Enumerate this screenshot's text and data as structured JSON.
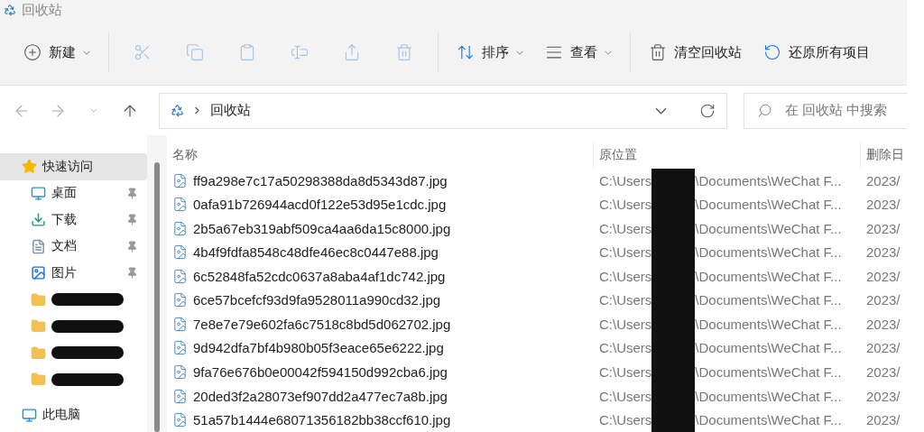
{
  "window": {
    "title": "回收站"
  },
  "toolbar": [
    {
      "kind": "new",
      "label": "新建",
      "dropdown": true,
      "disabled": false
    },
    {
      "kind": "cut",
      "disabled": true
    },
    {
      "kind": "copy",
      "disabled": true
    },
    {
      "kind": "paste",
      "disabled": true
    },
    {
      "kind": "rename",
      "disabled": true
    },
    {
      "kind": "share",
      "disabled": true
    },
    {
      "kind": "delete",
      "disabled": true
    },
    {
      "kind": "sort",
      "label": "排序",
      "dropdown": true,
      "disabled": false
    },
    {
      "kind": "view",
      "label": "查看",
      "dropdown": true,
      "disabled": false
    },
    {
      "kind": "empty",
      "label": "清空回收站",
      "dropdown": false,
      "disabled": false
    },
    {
      "kind": "restore",
      "label": "还原所有项目",
      "dropdown": false,
      "disabled": false
    }
  ],
  "address": {
    "crumbs": [
      "回收站"
    ],
    "search_placeholder": "在 回收站 中搜索"
  },
  "sidebar": {
    "items": [
      {
        "kind": "star",
        "label": "快速访问",
        "selected": true,
        "pinned": false,
        "children": [
          {
            "kind": "desktop",
            "label": "桌面",
            "selected": false,
            "pinned": true
          },
          {
            "kind": "download",
            "label": "下载",
            "selected": false,
            "pinned": true
          },
          {
            "kind": "document",
            "label": "文档",
            "selected": false,
            "pinned": true
          },
          {
            "kind": "pictures",
            "label": "图片",
            "selected": false,
            "pinned": true
          },
          {
            "kind": "redacted-folder",
            "selected": false,
            "pinned": false
          },
          {
            "kind": "redacted-folder",
            "selected": false,
            "pinned": false
          },
          {
            "kind": "redacted-folder",
            "selected": false,
            "pinned": false
          },
          {
            "kind": "redacted-folder",
            "selected": false,
            "pinned": false
          }
        ]
      },
      {
        "kind": "computer",
        "label": "此电脑",
        "selected": false,
        "pinned": false
      }
    ]
  },
  "table": {
    "columns": [
      "名称",
      "原位置",
      "删除日"
    ],
    "rows": [
      {
        "name": "ff9a298e7c17a50298388da8d5343d87.jpg",
        "location_start": "C:\\Users",
        "location_end": "\\Documents\\WeChat F...",
        "date": "2023/"
      },
      {
        "name": "0afa91b726944acd0f122e53d95e1cdc.jpg",
        "location_start": "C:\\Users",
        "location_end": "\\Documents\\WeChat F...",
        "date": "2023/"
      },
      {
        "name": "2b5a67eb319abf509ca4aa6da15c8000.jpg",
        "location_start": "C:\\Users",
        "location_end": "\\Documents\\WeChat F...",
        "date": "2023/"
      },
      {
        "name": "4b4f9fdfa8548c48dfe46ec8c0447e88.jpg",
        "location_start": "C:\\Users",
        "location_end": "\\Documents\\WeChat F...",
        "date": "2023/"
      },
      {
        "name": "6c52848fa52cdc0637a8aba4af1dc742.jpg",
        "location_start": "C:\\Users",
        "location_end": "\\Documents\\WeChat F...",
        "date": "2023/"
      },
      {
        "name": "6ce57bcefcf93d9fa9528011a990cd32.jpg",
        "location_start": "C:\\Users",
        "location_end": "\\Documents\\WeChat F...",
        "date": "2023/"
      },
      {
        "name": "7e8e7e79e602fa6c7518c8bd5d062702.jpg",
        "location_start": "C:\\Users",
        "location_end": "\\Documents\\WeChat F...",
        "date": "2023/"
      },
      {
        "name": "9d942dfa7bf4b980b05f3eace65e6222.jpg",
        "location_start": "C:\\Users",
        "location_end": "\\Documents\\WeChat F...",
        "date": "2023/"
      },
      {
        "name": "9fa76e676b0e00042f594150d992cba6.jpg",
        "location_start": "C:\\Users",
        "location_end": "\\Documents\\WeChat F...",
        "date": "2023/"
      },
      {
        "name": "20ded3f2a28073ef907dd2a477ec7a8b.jpg",
        "location_start": "C:\\Users",
        "location_end": "\\Documents\\WeChat F...",
        "date": "2023/"
      },
      {
        "name": "51a57b1444e68071356182bb38ccf610.jpg",
        "location_start": "C:\\Users",
        "location_end": "\\Documents\\WeChat F...",
        "date": "2023/"
      }
    ]
  }
}
